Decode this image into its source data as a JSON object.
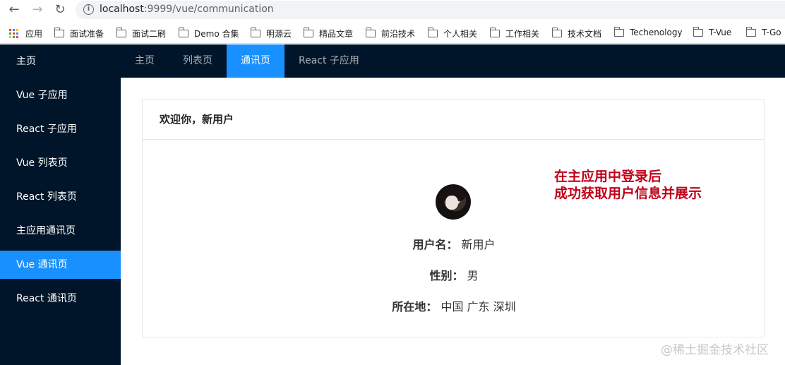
{
  "browser": {
    "url_host": "localhost",
    "url_rest": ":9999/vue/communication",
    "bookmarks": [
      "应用",
      "面试准备",
      "面试二刷",
      "Demo 合集",
      "明源云",
      "精品文章",
      "前沿技术",
      "个人相关",
      "工作相关",
      "技术文档",
      "Techenology",
      "T-Vue",
      "T-Go"
    ]
  },
  "sidebar": {
    "items": [
      {
        "label": "主页"
      },
      {
        "label": "Vue 子应用"
      },
      {
        "label": "React 子应用"
      },
      {
        "label": "Vue 列表页"
      },
      {
        "label": "React 列表页"
      },
      {
        "label": "主应用通讯页"
      },
      {
        "label": "Vue 通讯页"
      },
      {
        "label": "React 通讯页"
      }
    ],
    "active_index": 6
  },
  "topnav": {
    "tabs": [
      {
        "label": "主页"
      },
      {
        "label": "列表页"
      },
      {
        "label": "通讯页"
      },
      {
        "label": "React 子应用"
      }
    ],
    "active_index": 2
  },
  "card": {
    "title": "欢迎你，新用户",
    "username_label": "用户名：",
    "username": "新用户",
    "gender_label": "性别：",
    "gender": "男",
    "location_label": "所在地：",
    "location": "中国 广东 深圳"
  },
  "annotation": {
    "line1": "在主应用中登录后",
    "line2": "成功获取用户信息并展示"
  },
  "watermark": "@稀土掘金技术社区",
  "colors": {
    "sidebar_bg": "#001529",
    "accent": "#1890ff",
    "annotation": "#c0001a"
  }
}
